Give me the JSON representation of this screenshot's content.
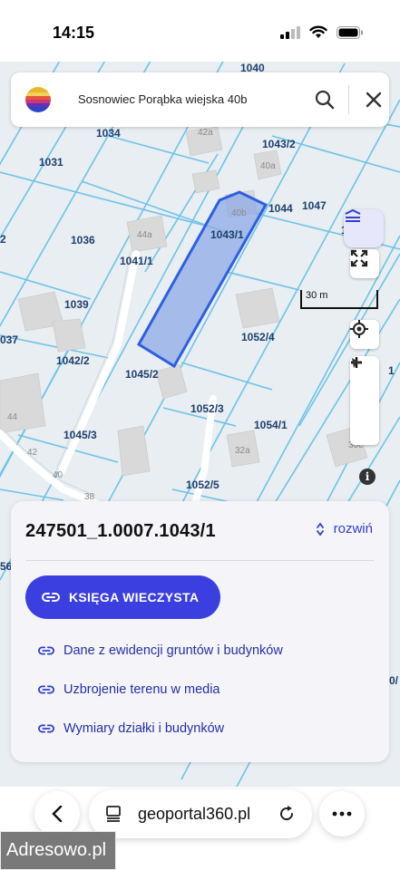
{
  "status": {
    "time": "14:15"
  },
  "search": {
    "query": "Sosnowiec Porąbka wiejska 40b"
  },
  "map": {
    "parcel_labels": [
      "1040",
      "1034",
      "1031",
      "1043/2",
      "1044",
      "1047",
      "1050",
      "1036",
      "1041/1",
      "1043/1",
      "1039",
      "037",
      "1042/2",
      "1045/2",
      "1052/4",
      "1052/3",
      "1054/1",
      "1045/3",
      "1052/5",
      "2",
      "1",
      "56",
      "0/"
    ],
    "building_labels": [
      "42a",
      "40a",
      "40b",
      "44a",
      "44",
      "42",
      "40",
      "38",
      "32a",
      "30c"
    ],
    "scale_label": "30 m",
    "highlight_color": "#3b6fe0"
  },
  "panel": {
    "parcel_id": "247501_1.0007.1043/1",
    "expand_label": "rozwiń",
    "primary_button": "KSIĘGA WIECZYSTA",
    "links": [
      "Dane z ewidencji gruntów i budynków",
      "Uzbrojenie terenu w media",
      "Wymiary działki i budynków"
    ]
  },
  "browser": {
    "url": "geoportal360.pl"
  },
  "watermark": "Adresowo.pl"
}
